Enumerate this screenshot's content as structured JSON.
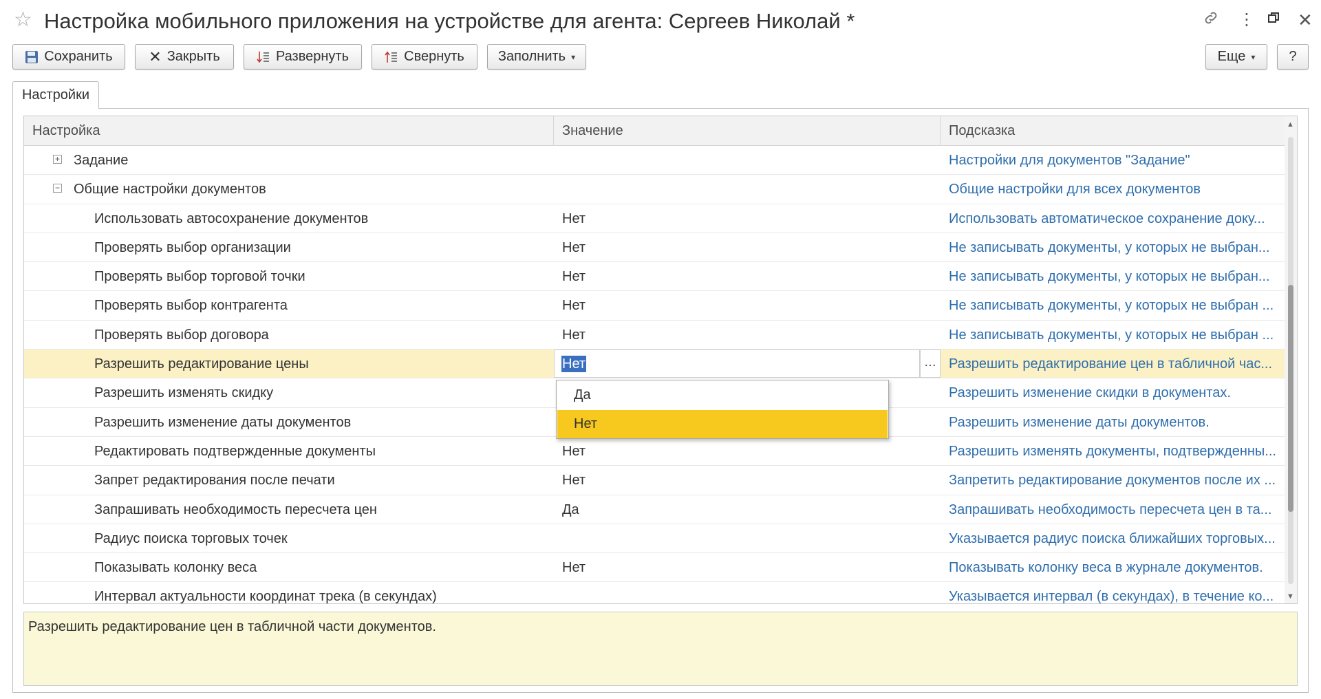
{
  "window": {
    "title": "Настройка мобильного приложения на устройстве для агента: Сергеев Николай *"
  },
  "toolbar": {
    "save": "Сохранить",
    "close": "Закрыть",
    "expand": "Развернуть",
    "collapse": "Свернуть",
    "fill": "Заполнить",
    "more": "Еще",
    "help": "?"
  },
  "tabs": [
    {
      "label": "Настройки",
      "active": true
    }
  ],
  "table": {
    "columns": [
      "Настройка",
      "Значение",
      "Подсказка"
    ],
    "rows": [
      {
        "name": "Задание",
        "value": "",
        "hint": "Настройки для документов \"Задание\"",
        "group": true,
        "expanded": false
      },
      {
        "name": "Общие настройки документов",
        "value": "",
        "hint": "Общие настройки для всех документов",
        "group": true,
        "expanded": true
      },
      {
        "name": "Использовать автосохранение документов",
        "value": "Нет",
        "hint": "Использовать автоматическое сохранение доку..."
      },
      {
        "name": "Проверять выбор организации",
        "value": "Нет",
        "hint": "Не записывать документы, у которых не выбран..."
      },
      {
        "name": "Проверять выбор торговой точки",
        "value": "Нет",
        "hint": "Не записывать документы, у которых не выбран..."
      },
      {
        "name": "Проверять выбор контрагента",
        "value": "Нет",
        "hint": "Не записывать документы, у которых не выбран ..."
      },
      {
        "name": "Проверять выбор договора",
        "value": "Нет",
        "hint": "Не записывать документы, у которых не выбран ..."
      },
      {
        "name": "Разрешить редактирование цены",
        "value": "Нет",
        "hint": "Разрешить редактирование цен в табличной час...",
        "selected": true
      },
      {
        "name": "Разрешить изменять скидку",
        "value": "",
        "hint": "Разрешить изменение скидки в документах."
      },
      {
        "name": "Разрешить изменение даты документов",
        "value": "",
        "hint": "Разрешить изменение даты документов."
      },
      {
        "name": "Редактировать подтвержденные документы",
        "value": "Нет",
        "hint": "Разрешить изменять документы, подтвержденны..."
      },
      {
        "name": "Запрет редактирования после печати",
        "value": "Нет",
        "hint": "Запретить редактирование документов после их ..."
      },
      {
        "name": "Запрашивать необходимость пересчета цен",
        "value": "Да",
        "hint": "Запрашивать необходимость пересчета цен в та..."
      },
      {
        "name": "Радиус поиска торговых точек",
        "value": "",
        "hint": "Указывается радиус поиска ближайших торговых..."
      },
      {
        "name": "Показывать колонку веса",
        "value": "Нет",
        "hint": "Показывать колонку веса в журнале документов."
      },
      {
        "name": "Интервал актуальности координат трека (в секундах)",
        "value": "",
        "hint": "Указывается интервал (в секундах), в течение ко..."
      }
    ]
  },
  "dropdown": {
    "options": [
      "Да",
      "Нет"
    ],
    "highlighted": "Нет"
  },
  "hint_text": "Разрешить редактирование цен в табличной части документов.",
  "colors": {
    "hint_link": "#2f6ead",
    "selected_row": "#fbf1c4",
    "dropdown_highlight": "#f7c81e",
    "hint_area": "#fbf8d8"
  },
  "icons": {
    "favorite": "star-icon",
    "link": "link-icon",
    "menu": "more-vertical-icon",
    "restore": "restore-window-icon",
    "close": "close-icon"
  }
}
